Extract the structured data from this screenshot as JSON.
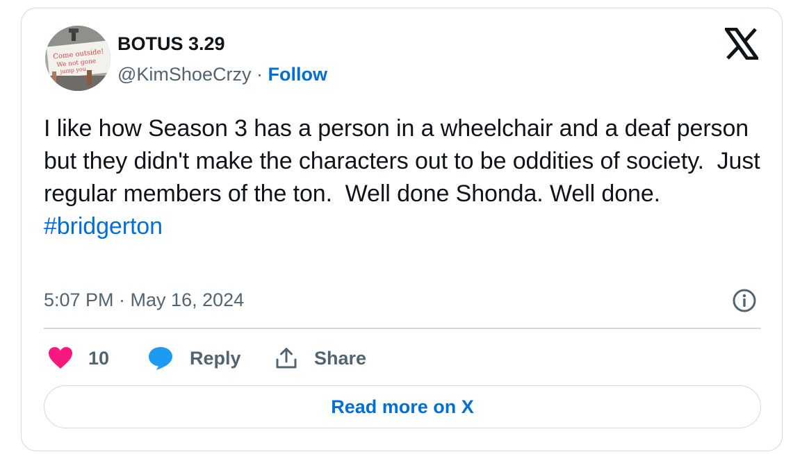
{
  "author": {
    "display_name": "BOTUS 3.29",
    "handle": "@KimShoeCrzy",
    "separator": "·",
    "follow_label": "Follow",
    "avatar_sign_text": [
      "Come outside!",
      "We not gone",
      "jump you"
    ]
  },
  "tweet": {
    "text": "I like how Season 3 has a person in a wheelchair and a deaf person but they didn't make the characters out to be oddities of society.  Just regular members of the ton.  Well done Shonda. Well done.",
    "hashtag": "#bridgerton",
    "timestamp": "5:07 PM · May 16, 2024"
  },
  "actions": {
    "like_count": "10",
    "reply_label": "Reply",
    "share_label": "Share"
  },
  "footer": {
    "read_more_label": "Read more on X"
  },
  "colors": {
    "link_blue": "#006fd6",
    "like_pink": "#f91880",
    "reply_blue": "#1d9bf0",
    "secondary_text": "#536471",
    "border": "#cfd9de"
  },
  "icons": {
    "brand": "x-logo-icon",
    "info": "info-icon",
    "like": "heart-icon",
    "reply": "speech-bubble-icon",
    "share": "share-upload-icon"
  }
}
